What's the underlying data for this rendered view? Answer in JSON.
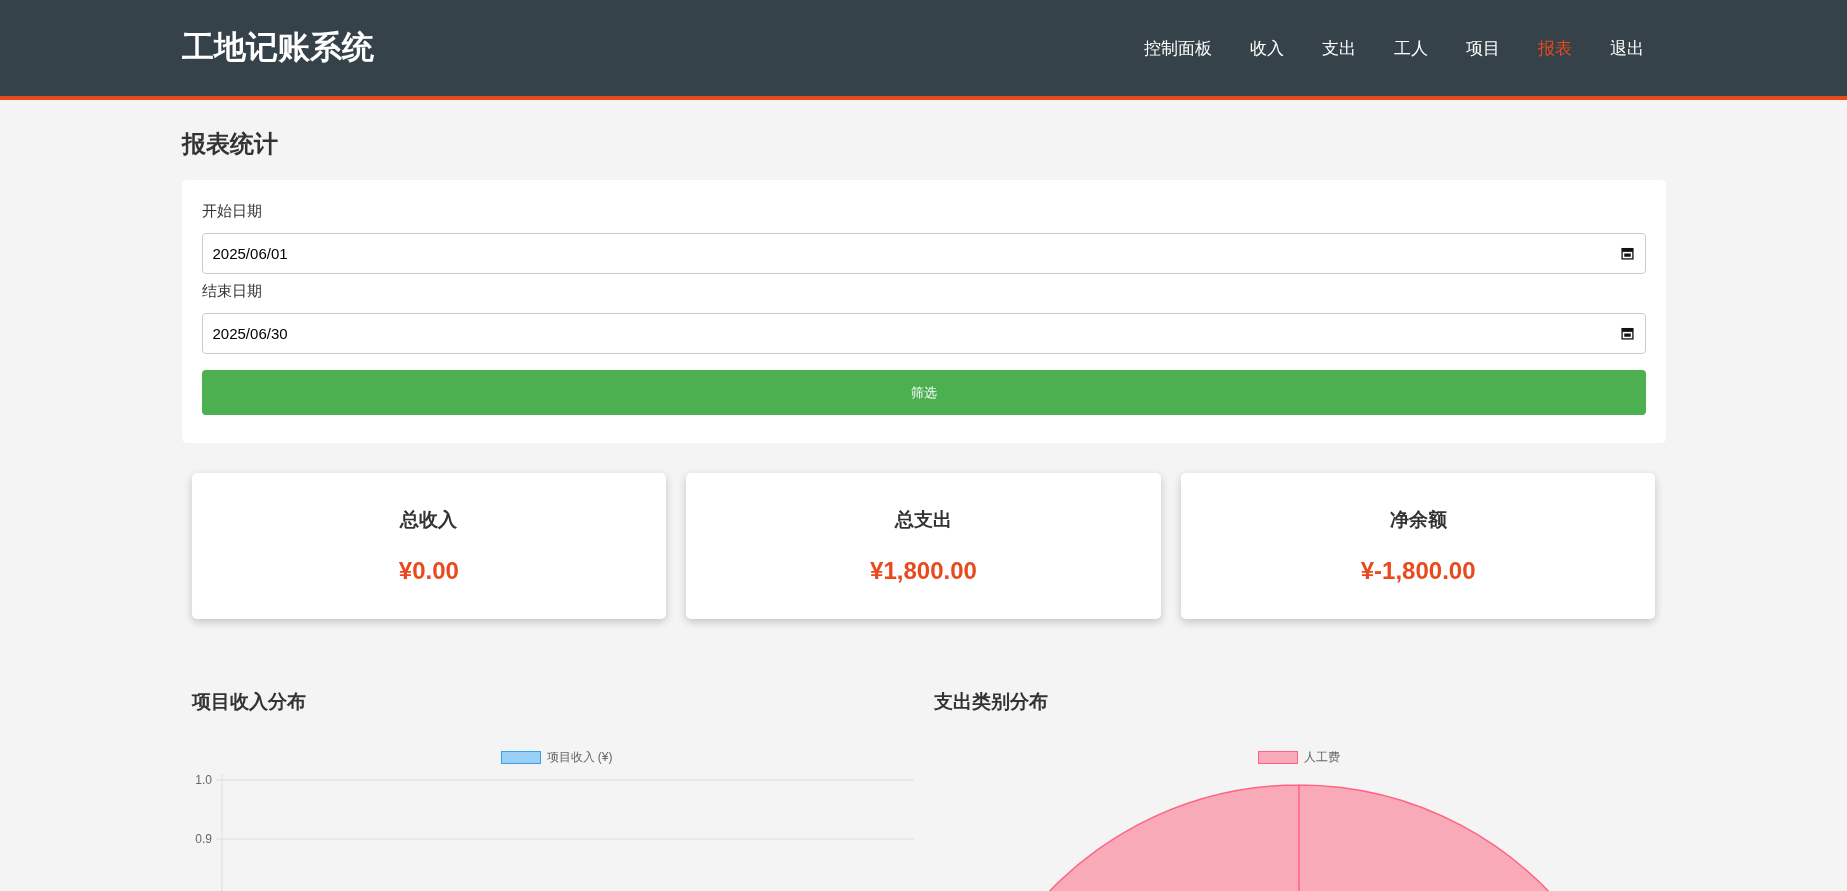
{
  "header": {
    "logo": "工地记账系统",
    "nav": [
      {
        "label": "控制面板",
        "selected": false
      },
      {
        "label": "收入",
        "selected": false
      },
      {
        "label": "支出",
        "selected": false
      },
      {
        "label": "工人",
        "selected": false
      },
      {
        "label": "项目",
        "selected": false
      },
      {
        "label": "报表",
        "selected": true
      },
      {
        "label": "退出",
        "selected": false
      }
    ]
  },
  "page_title": "报表统计",
  "filter": {
    "fields": [
      {
        "label": "开始日期",
        "value": "2025/06/01"
      },
      {
        "label": "结束日期",
        "value": "2025/06/30"
      }
    ],
    "button": "筛选"
  },
  "summary": [
    {
      "title": "总收入",
      "amount": "¥0.00"
    },
    {
      "title": "总支出",
      "amount": "¥1,800.00"
    },
    {
      "title": "净余额",
      "amount": "¥-1,800.00"
    }
  ],
  "charts": [
    {
      "title": "项目收入分布",
      "chart_data": {
        "type": "bar",
        "series": [
          {
            "name": "项目收入 (¥)",
            "color": "#9ad0f5"
          }
        ],
        "ylim": [
          0,
          1
        ],
        "yticks": [
          {
            "value": 1,
            "label": "1.0"
          },
          {
            "value": 0.9,
            "label": "0.9"
          }
        ]
      }
    },
    {
      "title": "支出类别分布",
      "chart_data": {
        "type": "pie",
        "categories": [
          "人工费"
        ],
        "colors": [
          "#f9aab9"
        ]
      }
    }
  ]
}
